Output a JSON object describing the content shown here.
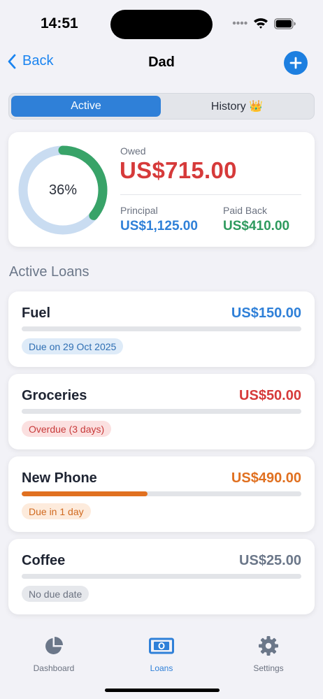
{
  "status_bar": {
    "time": "14:51"
  },
  "nav": {
    "back_label": "Back",
    "title": "Dad"
  },
  "segments": {
    "active_label": "Active",
    "history_label": "History 👑"
  },
  "summary": {
    "progress_percent": 36,
    "progress_text": "36%",
    "owed_label": "Owed",
    "owed_amount": "US$715.00",
    "principal_label": "Principal",
    "principal_amount": "US$1,125.00",
    "paid_label": "Paid Back",
    "paid_amount": "US$410.00"
  },
  "section_title": "Active Loans",
  "loans": [
    {
      "name": "Fuel",
      "amount": "US$150.00",
      "amount_color": "#2f80d8",
      "progress": 0,
      "bar_color": "#2f80d8",
      "status": "Due on 29 Oct 2025",
      "status_bg": "#deebf8",
      "status_color": "#2f6fb3"
    },
    {
      "name": "Groceries",
      "amount": "US$50.00",
      "amount_color": "#d63a3a",
      "progress": 0,
      "bar_color": "#d63a3a",
      "status": "Overdue (3 days)",
      "status_bg": "#fbe0e0",
      "status_color": "#c83a3a"
    },
    {
      "name": "New Phone",
      "amount": "US$490.00",
      "amount_color": "#e07020",
      "progress": 0.45,
      "bar_color": "#e07020",
      "status": "Due in 1  day",
      "status_bg": "#fdebdc",
      "status_color": "#d06a20"
    },
    {
      "name": "Coffee",
      "amount": "US$25.00",
      "amount_color": "#6b7789",
      "progress": 0,
      "bar_color": "#9aa0aa",
      "status": "No due date",
      "status_bg": "#e6e8ec",
      "status_color": "#6b7280"
    }
  ],
  "tabs": {
    "dashboard_label": "Dashboard",
    "loans_label": "Loans",
    "settings_label": "Settings"
  },
  "colors": {
    "accent": "#2f80d8",
    "owed": "#d63a3a",
    "paid": "#2e9a5e",
    "ring_track": "#c9dcf1",
    "ring_fill": "#38a368"
  }
}
